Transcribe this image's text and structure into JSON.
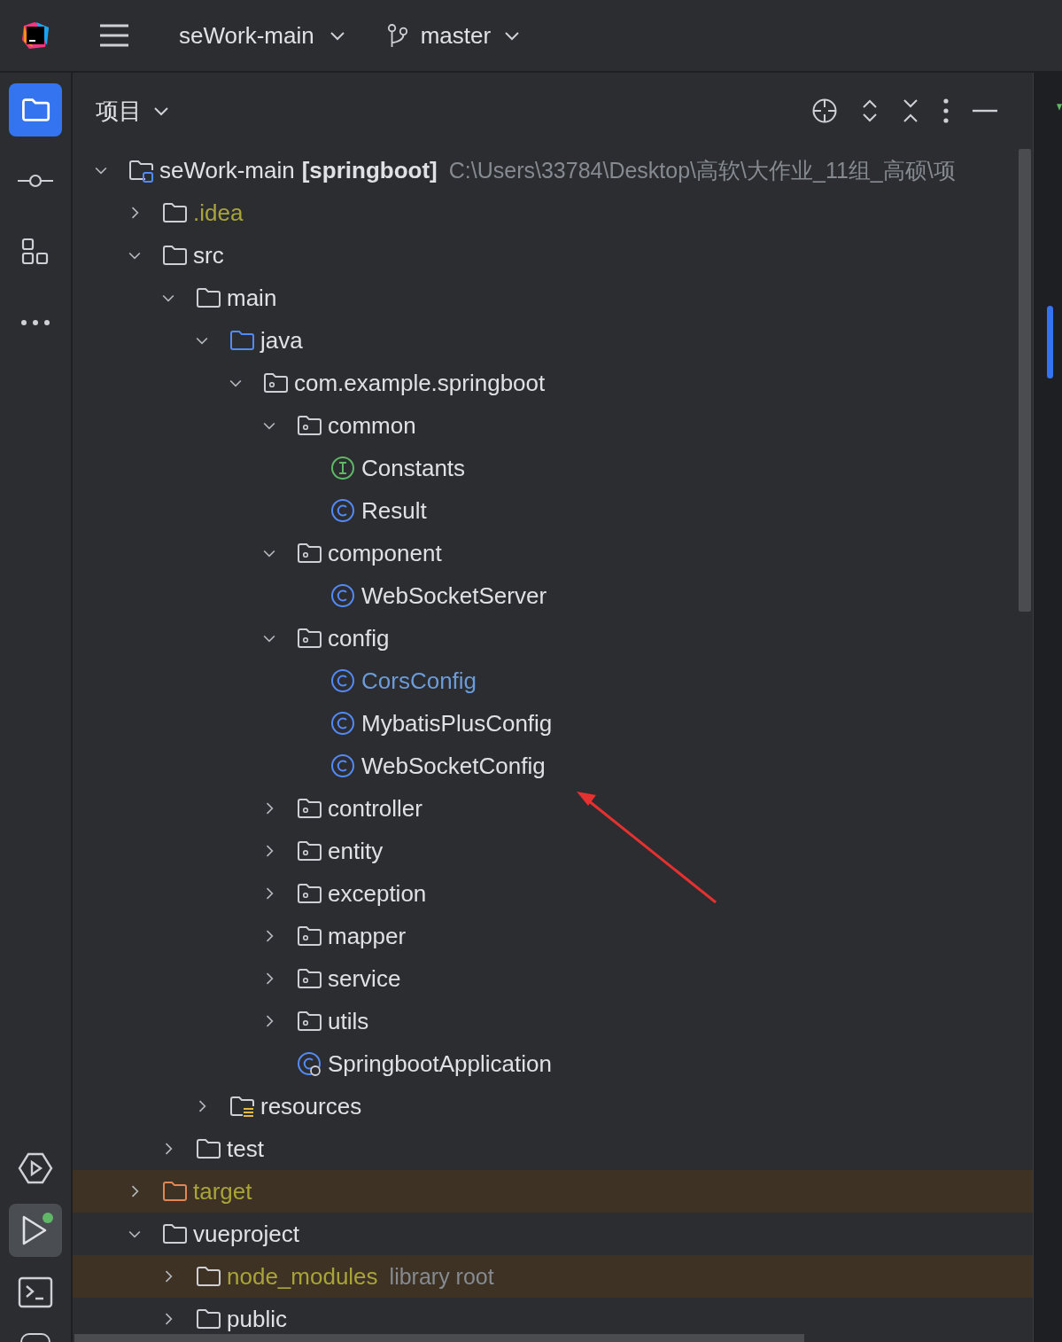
{
  "top_bar": {
    "project": "seWork-main",
    "branch": "master"
  },
  "tool_stripe": [
    {
      "kind": "project",
      "selected": true
    },
    {
      "kind": "commit",
      "selected": false
    },
    {
      "kind": "structure",
      "selected": false
    },
    {
      "kind": "more",
      "selected": false
    }
  ],
  "tool_stripe_bottom": [
    {
      "kind": "services",
      "selected": false
    },
    {
      "kind": "run",
      "selected": true
    },
    {
      "kind": "terminal",
      "selected": false
    }
  ],
  "panel": {
    "title": "项目"
  },
  "tree": [
    {
      "name": "seWork-main",
      "kind": "module",
      "module": "[springboot]",
      "path": "C:\\Users\\33784\\Desktop\\高软\\大作业_11组_高硕\\项",
      "ignored": false,
      "modified": false,
      "excluded": false,
      "expanded": true,
      "children": [
        {
          "name": ".idea",
          "kind": "folder",
          "ignored": true,
          "modified": false,
          "excluded": false,
          "expanded": false
        },
        {
          "name": "src",
          "kind": "folder",
          "ignored": false,
          "modified": false,
          "excluded": false,
          "expanded": true,
          "children": [
            {
              "name": "main",
              "kind": "folder",
              "ignored": false,
              "modified": false,
              "excluded": false,
              "expanded": true,
              "children": [
                {
                  "name": "java",
                  "kind": "source",
                  "ignored": false,
                  "modified": false,
                  "excluded": false,
                  "expanded": true,
                  "children": [
                    {
                      "name": "com.example.springboot",
                      "kind": "package",
                      "ignored": false,
                      "modified": false,
                      "excluded": false,
                      "expanded": true,
                      "children": [
                        {
                          "name": "common",
                          "kind": "package",
                          "ignored": false,
                          "modified": false,
                          "excluded": false,
                          "expanded": true,
                          "children": [
                            {
                              "name": "Constants",
                              "kind": "interface",
                              "ignored": false,
                              "modified": false,
                              "excluded": false
                            },
                            {
                              "name": "Result",
                              "kind": "class",
                              "ignored": false,
                              "modified": false,
                              "excluded": false
                            }
                          ]
                        },
                        {
                          "name": "component",
                          "kind": "package",
                          "ignored": false,
                          "modified": false,
                          "excluded": false,
                          "expanded": true,
                          "children": [
                            {
                              "name": "WebSocketServer",
                              "kind": "class",
                              "ignored": false,
                              "modified": false,
                              "excluded": false
                            }
                          ]
                        },
                        {
                          "name": "config",
                          "kind": "package",
                          "ignored": false,
                          "modified": false,
                          "excluded": false,
                          "expanded": true,
                          "children": [
                            {
                              "name": "CorsConfig",
                              "kind": "class",
                              "ignored": false,
                              "modified": true,
                              "excluded": false
                            },
                            {
                              "name": "MybatisPlusConfig",
                              "kind": "class",
                              "ignored": false,
                              "modified": false,
                              "excluded": false
                            },
                            {
                              "name": "WebSocketConfig",
                              "kind": "class",
                              "ignored": false,
                              "modified": false,
                              "excluded": false
                            }
                          ]
                        },
                        {
                          "name": "controller",
                          "kind": "package",
                          "ignored": false,
                          "modified": false,
                          "excluded": false,
                          "expanded": false
                        },
                        {
                          "name": "entity",
                          "kind": "package",
                          "ignored": false,
                          "modified": false,
                          "excluded": false,
                          "expanded": false
                        },
                        {
                          "name": "exception",
                          "kind": "package",
                          "ignored": false,
                          "modified": false,
                          "excluded": false,
                          "expanded": false
                        },
                        {
                          "name": "mapper",
                          "kind": "package",
                          "ignored": false,
                          "modified": false,
                          "excluded": false,
                          "expanded": false
                        },
                        {
                          "name": "service",
                          "kind": "package",
                          "ignored": false,
                          "modified": false,
                          "excluded": false,
                          "expanded": false
                        },
                        {
                          "name": "utils",
                          "kind": "package",
                          "ignored": false,
                          "modified": false,
                          "excluded": false,
                          "expanded": false
                        },
                        {
                          "name": "SpringbootApplication",
                          "kind": "boot",
                          "ignored": false,
                          "modified": false,
                          "excluded": false
                        }
                      ]
                    }
                  ]
                },
                {
                  "name": "resources",
                  "kind": "resources",
                  "ignored": false,
                  "modified": false,
                  "excluded": false,
                  "expanded": false
                }
              ]
            },
            {
              "name": "test",
              "kind": "folder",
              "ignored": false,
              "modified": false,
              "excluded": false,
              "expanded": false
            }
          ]
        },
        {
          "name": "target",
          "kind": "excluded",
          "ignored": false,
          "modified": false,
          "excluded": true,
          "expanded": false
        },
        {
          "name": "vueproject",
          "kind": "folder",
          "ignored": false,
          "modified": false,
          "excluded": false,
          "expanded": true,
          "children": [
            {
              "name": "node_modules",
              "kind": "folder",
              "ignored": false,
              "modified": false,
              "excluded": true,
              "note": "library root",
              "expanded": false
            },
            {
              "name": "public",
              "kind": "folder",
              "ignored": false,
              "modified": false,
              "excluded": false,
              "expanded": false
            }
          ]
        }
      ]
    }
  ],
  "annotations": [
    {
      "kind": "arrow"
    }
  ]
}
